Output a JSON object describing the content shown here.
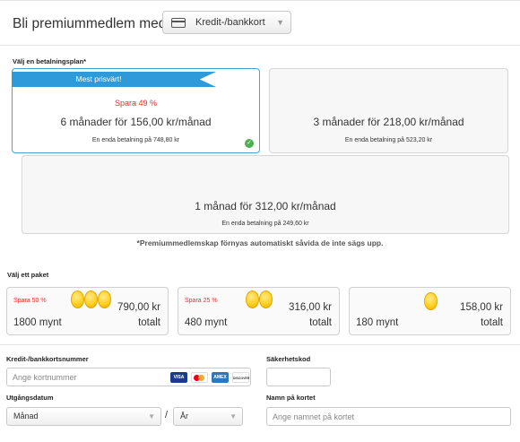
{
  "header": {
    "title": "Bli premiummedlem med"
  },
  "payment_method": {
    "selected": "Kredit-/bankkort",
    "icon": "credit-card-icon"
  },
  "plans_section": {
    "label": "Välj en betalningsplan*",
    "plans": [
      {
        "badge": "Mest prisvärt!",
        "save": "Spara 49 %",
        "main": "6 månader för 156,00 kr/månad",
        "sub": "En enda betalning på 748,80 kr",
        "selected": true
      },
      {
        "main": "3 månader för 218,00 kr/månad",
        "sub": "En enda betalning på 523,20 kr",
        "selected": false
      },
      {
        "main": "1 månad för 312,00 kr/månad",
        "sub": "En enda betalning på 249,60 kr",
        "selected": false
      }
    ],
    "note": "*Premiummedlemskap förnyas automatiskt såvida de inte sägs upp."
  },
  "packages_section": {
    "label": "Välj ett paket",
    "packages": [
      {
        "save": "Spara 50 %",
        "coins": "1800 mynt",
        "price": "790,00 kr",
        "total": "totalt"
      },
      {
        "save": "Spara 25 %",
        "coins": "480 mynt",
        "price": "316,00 kr",
        "total": "totalt"
      },
      {
        "coins": "180 mynt",
        "price": "158,00 kr",
        "total": "totalt"
      }
    ]
  },
  "form": {
    "card_number": {
      "label": "Kredit-/bankkortsnummer",
      "placeholder": "Ange kortnummer",
      "logos": [
        "VISA",
        "mastercard",
        "AMEX",
        "DISCOVER"
      ]
    },
    "security_code": {
      "label": "Säkerhetskod",
      "placeholder": ""
    },
    "expiry": {
      "label": "Utgångsdatum",
      "month": "Månad",
      "separator": "/",
      "year": "År"
    },
    "name": {
      "label": "Namn på kortet",
      "placeholder": "Ange namnet på kortet"
    }
  },
  "colors": {
    "accent": "#2e9ad9",
    "save_red": "#e0312b",
    "coin": "#ffcf1a",
    "check": "#4caf50"
  }
}
